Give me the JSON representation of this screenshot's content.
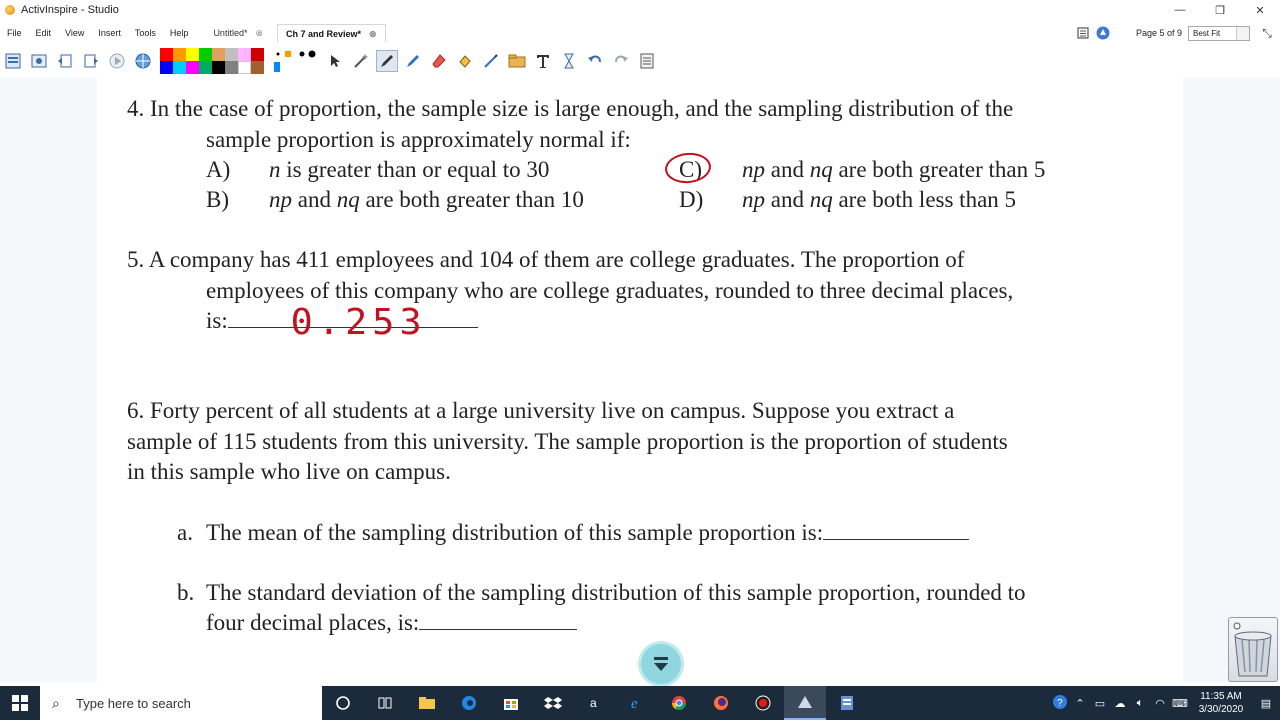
{
  "window": {
    "title": "ActivInspire - Studio",
    "controls": {
      "minimize": "—",
      "restore": "❐",
      "close": "✕"
    }
  },
  "menu": {
    "items": [
      "File",
      "Edit",
      "View",
      "Insert",
      "Tools",
      "Help"
    ],
    "tabs": [
      {
        "label": "Untitled*",
        "close": "⊗",
        "active": false
      },
      {
        "label": "Ch 7 and Review*",
        "close": "⊗",
        "active": true
      }
    ],
    "page_label": "Page 5 of 9",
    "zoom_value": "Best Fit"
  },
  "toolbar": {
    "palette_colors": [
      "#ff0000",
      "#ff9900",
      "#ffff00",
      "#00cc00",
      "#e0a060",
      "#c0c0c0",
      "#ffb6ff",
      "#cc0000",
      "#0000ff",
      "#00ccff",
      "#ff00ff",
      "#00aa66",
      "#000000",
      "#808080",
      "#ffffff",
      "#a06030"
    ],
    "tools": [
      "select-icon",
      "magic-icon",
      "pen-icon",
      "highlighter-icon",
      "eraser-icon",
      "fill-icon",
      "marker-icon",
      "folder-icon",
      "text-icon",
      "hourglass-icon",
      "undo-icon",
      "redo-icon",
      "page-icon"
    ]
  },
  "page": {
    "q4": {
      "line1": "4. In the case of proportion, the sample size is large enough, and the sampling distribution of the",
      "line2": "sample proportion is approximately normal if:",
      "optA_letter": "A)",
      "optA_text_var": "n",
      "optA_text": " is greater than or equal to 30",
      "optB_letter": "B)",
      "optB_np": "np",
      "optB_and": " and ",
      "optB_nq": "nq",
      "optB_text": " are both greater than 10",
      "optC_letter": "C)",
      "optC_np": "np",
      "optC_and": " and ",
      "optC_nq": "nq",
      "optC_text": " are both greater than 5",
      "optD_letter": "D)",
      "optD_np": "np",
      "optD_and": " and ",
      "optD_nq": "nq",
      "optD_text": " are both less than 5"
    },
    "q5": {
      "line1": "5. A company has 411 employees and 104 of them are college graduates. The proportion of",
      "line2": "employees of this company who are college graduates, rounded to three decimal places,",
      "line3": "is:",
      "answer": "0.253"
    },
    "q6": {
      "line1": "6. Forty percent of all students at a large university live on campus. Suppose you extract a",
      "line2": "sample of 115 students from this university. The sample proportion is the proportion of students",
      "line3": "in this sample who live on campus.",
      "a_label": "a.",
      "a_text": "The mean of the sampling distribution of this sample proportion is:",
      "b_label": "b.",
      "b_line1": "The standard deviation of the sampling distribution of this sample proportion, rounded to",
      "b_line2": "four decimal places, is:"
    }
  },
  "taskbar": {
    "search_placeholder": "Type here to search",
    "time": "11:35 AM",
    "date": "3/30/2020"
  }
}
